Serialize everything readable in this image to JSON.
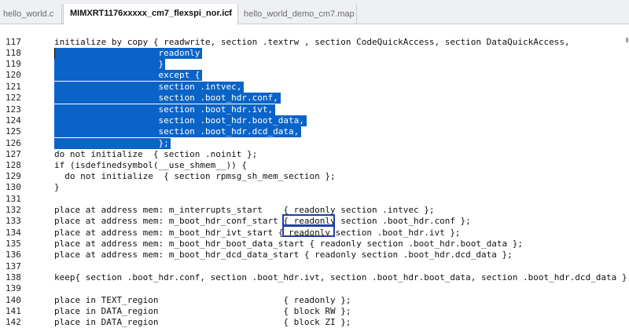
{
  "tabs": [
    {
      "label": "hello_world.c",
      "active": false
    },
    {
      "label": "MIMXRT1176xxxxx_cm7_flexspi_nor.icf",
      "active": true,
      "close": "×"
    },
    {
      "label": "hello_world_demo_cm7.map",
      "active": false
    }
  ],
  "colors": {
    "selection": "#0a64c8",
    "highlight_box": "#1f3fa8"
  },
  "editor": {
    "lines": [
      {
        "n": "117",
        "text": "initialize by copy { readwrite, section .textrw , section CodeQuickAccess, section DataQuickAccess,",
        "selected": false
      },
      {
        "n": "118",
        "text": "                    readonly",
        "selected": true
      },
      {
        "n": "119",
        "text": "                    }",
        "selected": true
      },
      {
        "n": "120",
        "text": "                    except {",
        "selected": true
      },
      {
        "n": "121",
        "text": "                    section .intvec,",
        "selected": true
      },
      {
        "n": "122",
        "text": "                    section .boot_hdr.conf,",
        "selected": true
      },
      {
        "n": "123",
        "text": "                    section .boot_hdr.ivt,",
        "selected": true
      },
      {
        "n": "124",
        "text": "                    section .boot_hdr.boot_data,",
        "selected": true
      },
      {
        "n": "125",
        "text": "                    section .boot_hdr.dcd_data,",
        "selected": true
      },
      {
        "n": "126",
        "text": "                    };",
        "selected": true
      },
      {
        "n": "127",
        "text": "do not initialize  { section .noinit };",
        "selected": false
      },
      {
        "n": "128",
        "text": "if (isdefinedsymbol(__use_shmem__)) {",
        "selected": false
      },
      {
        "n": "129",
        "text": "  do not initialize  { section rpmsg_sh_mem_section };",
        "selected": false
      },
      {
        "n": "130",
        "text": "}",
        "selected": false
      },
      {
        "n": "131",
        "text": "",
        "selected": false
      },
      {
        "n": "132",
        "text": "place at address mem: m_interrupts_start    { readonly section .intvec };",
        "selected": false
      },
      {
        "n": "133",
        "text": "place at address mem: m_boot_hdr_conf_start { readonly section .boot_hdr.conf };",
        "selected": false
      },
      {
        "n": "134",
        "text": "place at address mem: m_boot_hdr_ivt_start { readonly section .boot_hdr.ivt };",
        "selected": false
      },
      {
        "n": "135",
        "text": "place at address mem: m_boot_hdr_boot_data_start { readonly section .boot_hdr.boot_data };",
        "selected": false
      },
      {
        "n": "136",
        "text": "place at address mem: m_boot_hdr_dcd_data_start { readonly section .boot_hdr.dcd_data };",
        "selected": false
      },
      {
        "n": "137",
        "text": "",
        "selected": false
      },
      {
        "n": "138",
        "text": "keep{ section .boot_hdr.conf, section .boot_hdr.ivt, section .boot_hdr.boot_data, section .boot_hdr.dcd_data };",
        "selected": false
      },
      {
        "n": "139",
        "text": "",
        "selected": false
      },
      {
        "n": "140",
        "text": "place in TEXT_region                        { readonly };",
        "selected": false
      },
      {
        "n": "141",
        "text": "place in DATA_region                        { block RW };",
        "selected": false
      },
      {
        "n": "142",
        "text": "place in DATA_region                        { block ZI };",
        "selected": false
      }
    ]
  }
}
